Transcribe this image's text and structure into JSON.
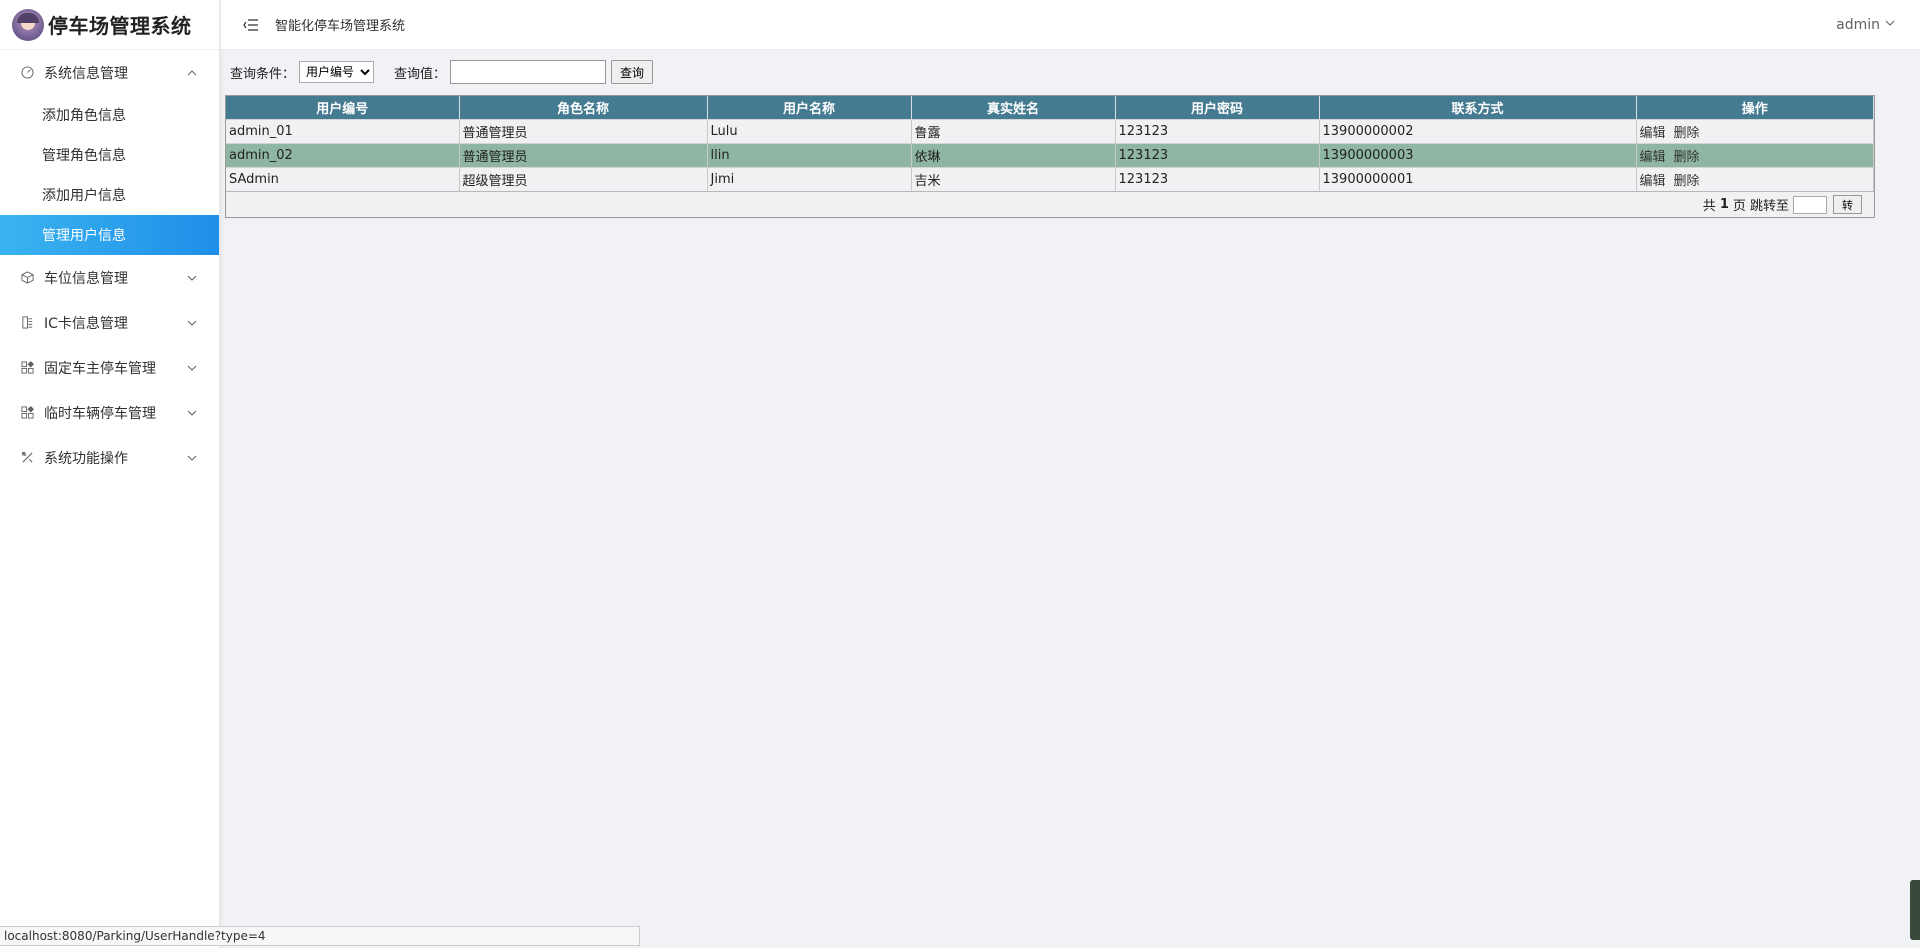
{
  "app": {
    "logo_text": "停车场管理系统",
    "header_title": "智能化停车场管理系统",
    "user": "admin"
  },
  "sidebar": {
    "groups": [
      {
        "label": "系统信息管理",
        "icon": "gauge-icon",
        "expanded": true,
        "items": [
          {
            "label": "添加角色信息"
          },
          {
            "label": "管理角色信息"
          },
          {
            "label": "添加用户信息"
          },
          {
            "label": "管理用户信息",
            "active": true
          }
        ]
      },
      {
        "label": "车位信息管理",
        "icon": "cube-icon"
      },
      {
        "label": "IC卡信息管理",
        "icon": "card-icon"
      },
      {
        "label": "固定车主停车管理",
        "icon": "grid-icon"
      },
      {
        "label": "临时车辆停车管理",
        "icon": "grid-icon"
      },
      {
        "label": "系统功能操作",
        "icon": "tools-icon"
      }
    ]
  },
  "query": {
    "condition_label": "查询条件：",
    "condition_selected": "用户编号",
    "value_label": "查询值：",
    "value": "",
    "submit": "查询"
  },
  "table": {
    "headers": [
      "用户编号",
      "角色名称",
      "用户名称",
      "真实姓名",
      "用户密码",
      "联系方式",
      "操作"
    ],
    "rows": [
      [
        "admin_01",
        "普通管理员",
        "Lulu",
        "鲁露",
        "123123",
        "13900000002"
      ],
      [
        "admin_02",
        "普通管理员",
        "llin",
        "依琳",
        "123123",
        "13900000003"
      ],
      [
        "SAdmin",
        "超级管理员",
        "Jimi",
        "吉米",
        "123123",
        "13900000001"
      ]
    ],
    "selected_row": 1,
    "edit_label": "编辑",
    "delete_label": "删除"
  },
  "pager": {
    "prefix": "共",
    "total_pages": "1",
    "suffix": "页 跳转至",
    "go_label": "转"
  },
  "status_bar": "localhost:8080/Parking/UserHandle?type=4",
  "colors": {
    "table_header": "#457b91",
    "selected_row": "#8fb5a3",
    "active_menu": "#1f8ee8"
  }
}
